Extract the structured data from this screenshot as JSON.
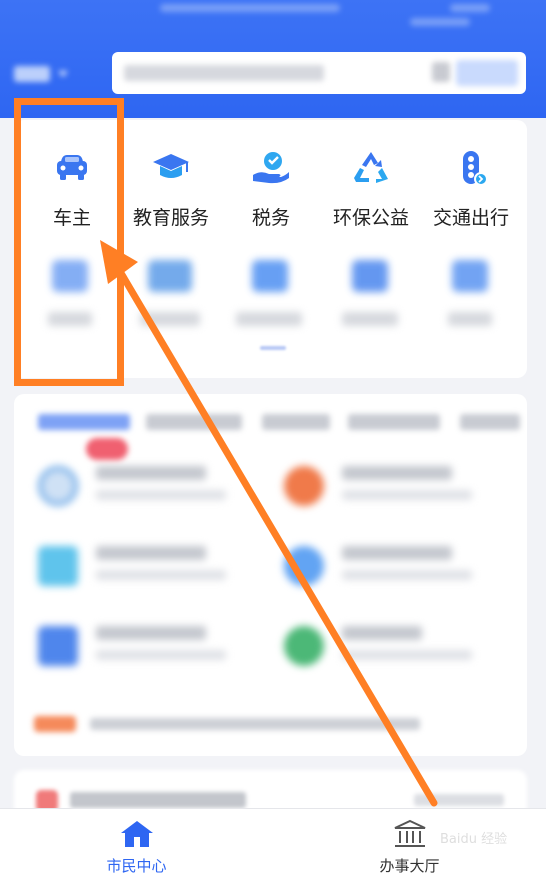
{
  "header": {
    "city": "",
    "search_placeholder": "",
    "search_button": ""
  },
  "services": [
    {
      "label": "车主",
      "icon": "car-icon"
    },
    {
      "label": "教育服务",
      "icon": "graduation-cap-icon"
    },
    {
      "label": "税务",
      "icon": "tax-hand-icon"
    },
    {
      "label": "环保公益",
      "icon": "recycle-icon"
    },
    {
      "label": "交通出行",
      "icon": "traffic-light-icon"
    }
  ],
  "tabbar": {
    "items": [
      {
        "label": "市民中心",
        "icon": "home-icon",
        "active": true
      },
      {
        "label": "办事大厅",
        "icon": "bank-building-icon",
        "active": false
      }
    ]
  },
  "watermark": {
    "text": "Baidu 经验"
  },
  "annotation": {
    "color": "#ff7f24"
  },
  "colors": {
    "brand": "#2e66f2",
    "annotation": "#ff7f24"
  }
}
